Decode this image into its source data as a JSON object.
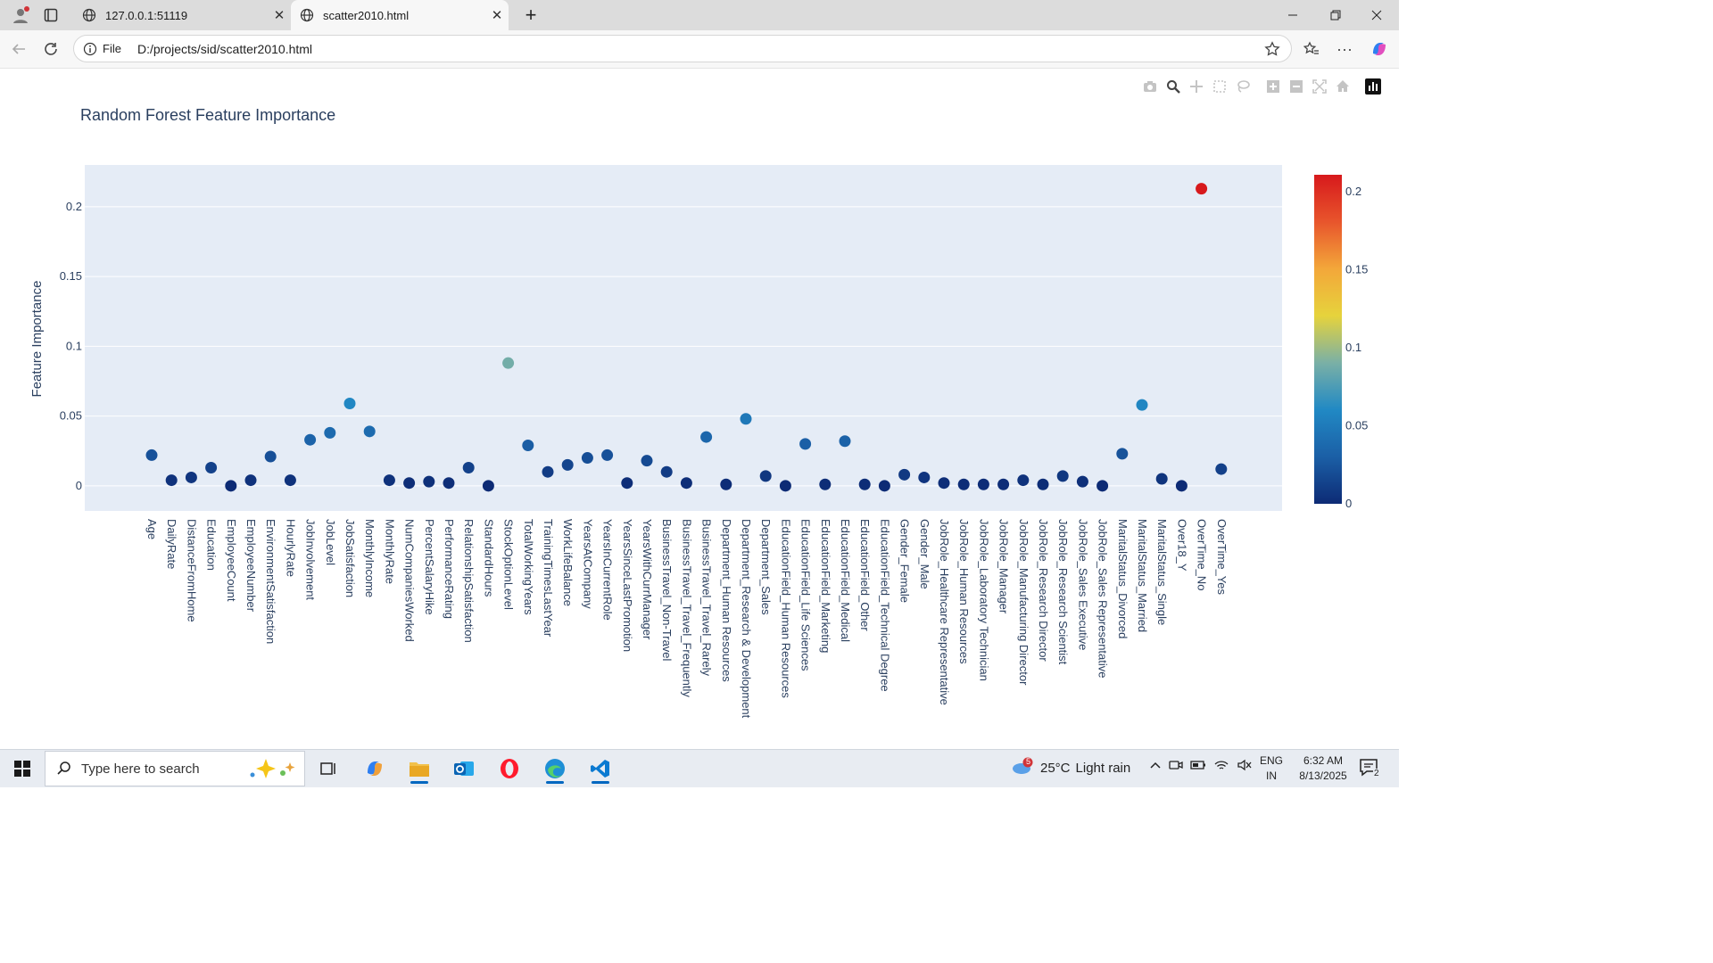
{
  "browser": {
    "tabs": [
      {
        "label": "127.0.0.1:51119",
        "active": false
      },
      {
        "label": "scatter2010.html",
        "active": true
      }
    ],
    "url_scheme": "File",
    "url": "D:/projects/sid/scatter2010.html"
  },
  "modebar": {
    "icons": [
      "camera-icon",
      "zoom-icon",
      "pan-icon",
      "box-select-icon",
      "lasso-icon",
      "zoom-in-icon",
      "zoom-out-icon",
      "autoscale-icon",
      "reset-axes-icon",
      "plotly-logo-icon"
    ]
  },
  "chart_data": {
    "type": "scatter",
    "title": "Random Forest Feature Importance",
    "xlabel": "",
    "ylabel": "Feature Importance",
    "ylim": [
      -0.018,
      0.23
    ],
    "yticks": [
      0,
      0.05,
      0.1,
      0.15,
      0.2
    ],
    "ytick_labels": [
      "0",
      "0.05",
      "0.1",
      "0.15",
      "0.2"
    ],
    "colorbar": {
      "range": [
        0,
        0.211
      ],
      "ticks": [
        0,
        0.05,
        0.1,
        0.15,
        0.2
      ],
      "tick_labels": [
        "0",
        "0.05",
        "0.1",
        "0.15",
        "0.2"
      ],
      "colorscale": [
        "#0d2b75",
        "#1b5fa6",
        "#2189c4",
        "#7ab0a6",
        "#e6d33c",
        "#f3a73a",
        "#e8552c",
        "#d7191c"
      ]
    },
    "background": "#e5ecf6",
    "x": [
      "Age",
      "DailyRate",
      "DistanceFromHome",
      "Education",
      "EmployeeCount",
      "EmployeeNumber",
      "EnvironmentSatisfaction",
      "HourlyRate",
      "JobInvolvement",
      "JobLevel",
      "JobSatisfaction",
      "MonthlyIncome",
      "MonthlyRate",
      "NumCompaniesWorked",
      "PercentSalaryHike",
      "PerformanceRating",
      "RelationshipSatisfaction",
      "StandardHours",
      "StockOptionLevel",
      "TotalWorkingYears",
      "TrainingTimesLastYear",
      "WorkLifeBalance",
      "YearsAtCompany",
      "YearsInCurrentRole",
      "YearsSinceLastPromotion",
      "YearsWithCurrManager",
      "BusinessTravel_Non-Travel",
      "BusinessTravel_Travel_Frequently",
      "BusinessTravel_Travel_Rarely",
      "Department_Human Resources",
      "Department_Research & Development",
      "Department_Sales",
      "EducationField_Human Resources",
      "EducationField_Life Sciences",
      "EducationField_Marketing",
      "EducationField_Medical",
      "EducationField_Other",
      "EducationField_Technical Degree",
      "Gender_Female",
      "Gender_Male",
      "JobRole_Healthcare Representative",
      "JobRole_Human Resources",
      "JobRole_Laboratory Technician",
      "JobRole_Manager",
      "JobRole_Manufacturing Director",
      "JobRole_Research Director",
      "JobRole_Research Scientist",
      "JobRole_Sales Executive",
      "JobRole_Sales Representative",
      "MaritalStatus_Divorced",
      "MaritalStatus_Married",
      "MaritalStatus_Single",
      "Over18_Y",
      "OverTime_No",
      "OverTime_Yes"
    ],
    "y": [
      0.022,
      0.004,
      0.006,
      0.013,
      0.0,
      0.004,
      0.021,
      0.004,
      0.033,
      0.038,
      0.059,
      0.039,
      0.004,
      0.002,
      0.003,
      0.002,
      0.013,
      0.0,
      0.088,
      0.029,
      0.01,
      0.015,
      0.02,
      0.022,
      0.002,
      0.018,
      0.01,
      0.002,
      0.035,
      0.001,
      0.048,
      0.007,
      0.0,
      0.03,
      0.001,
      0.032,
      0.001,
      0.0,
      0.008,
      0.006,
      0.002,
      0.001,
      0.001,
      0.001,
      0.004,
      0.001,
      0.007,
      0.003,
      0.0,
      0.023,
      0.058,
      0.005,
      0.0,
      0.213,
      0.012
    ]
  },
  "taskbar": {
    "search_placeholder": "Type here to search",
    "weather_temp": "25°C",
    "weather_text": "Light rain",
    "weather_badge": "5",
    "lang_line1": "ENG",
    "lang_line2": "IN",
    "time": "6:32 AM",
    "date": "8/13/2025",
    "notification_count": "2"
  }
}
